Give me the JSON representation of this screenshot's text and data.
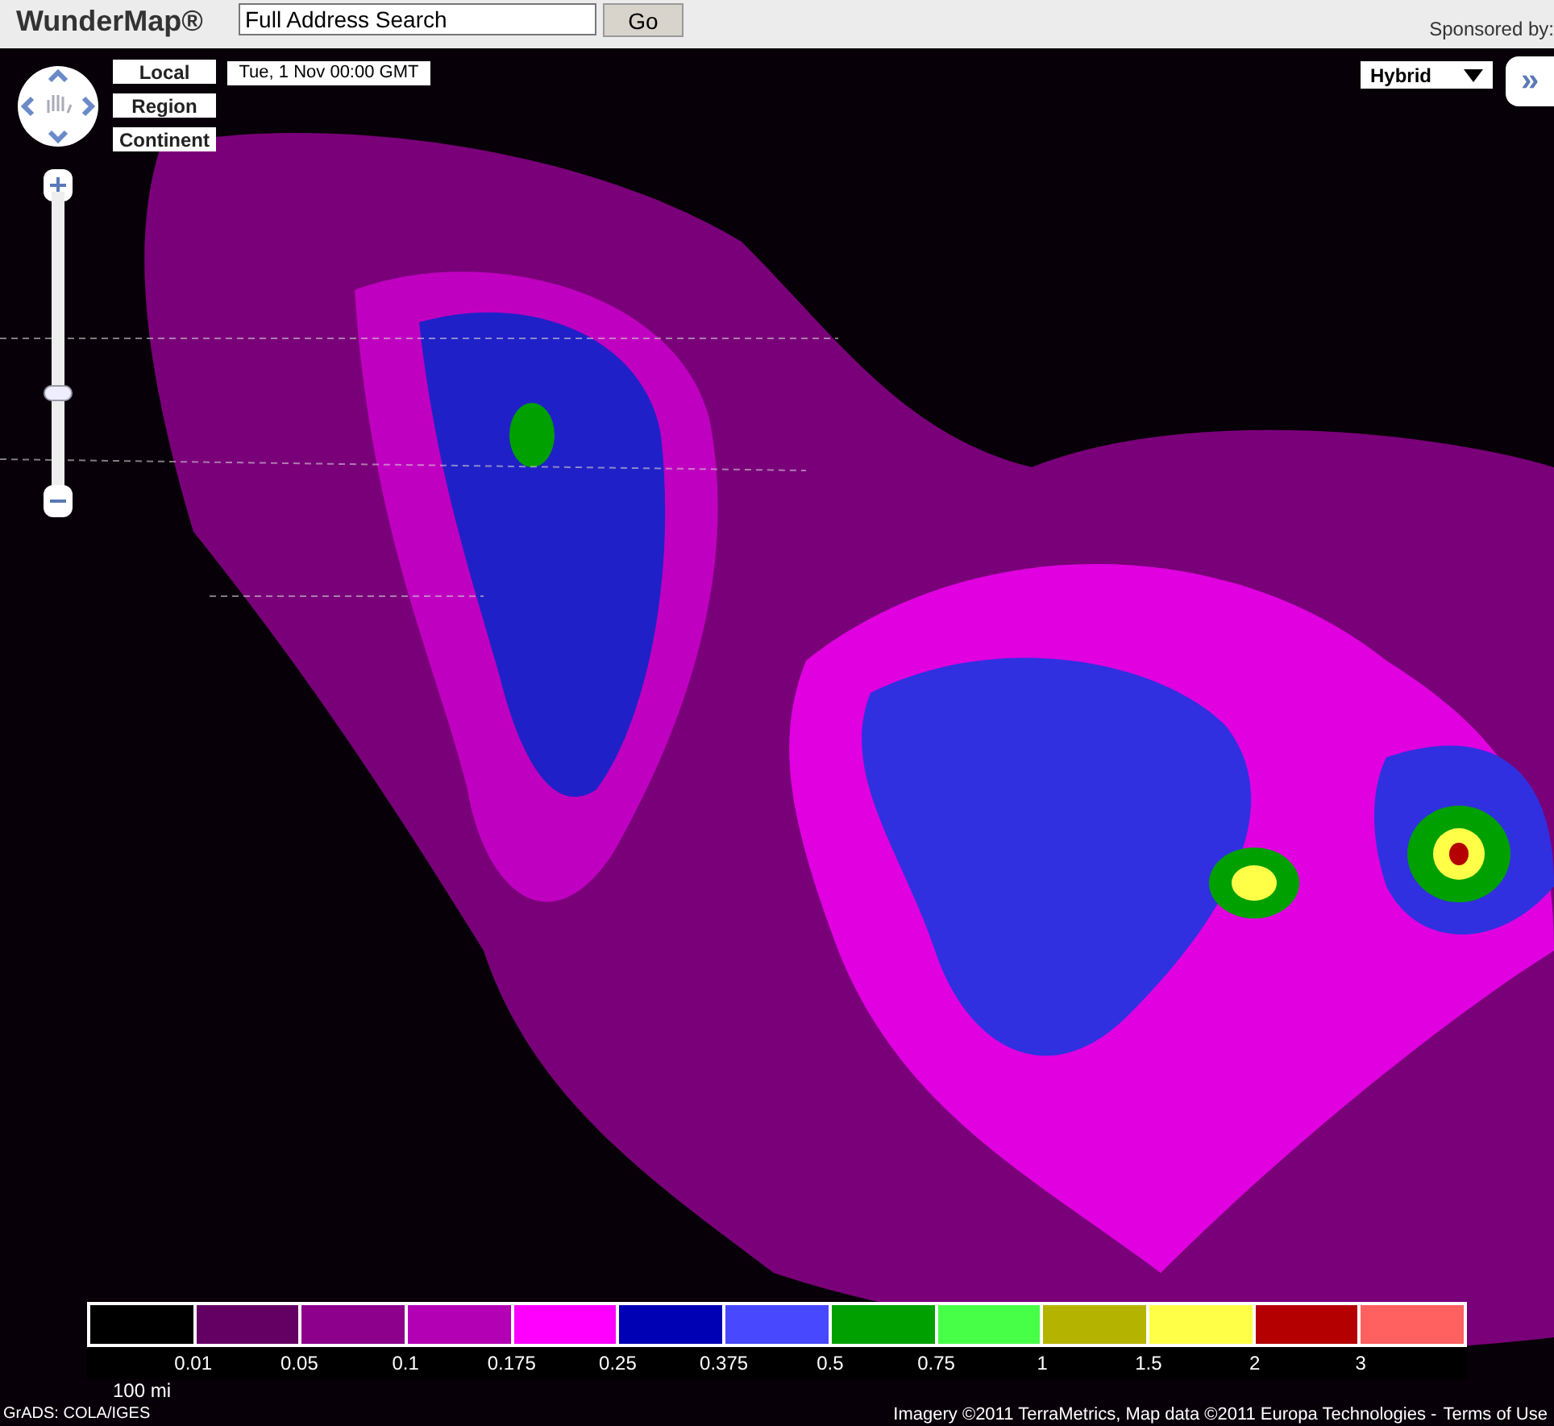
{
  "header": {
    "title": "WunderMap®",
    "search": {
      "value": "Full Address Search"
    },
    "go_button": "Go",
    "sponsor": "Sponsored by:"
  },
  "map": {
    "view_buttons": [
      {
        "label": "Local"
      },
      {
        "label": "Region"
      },
      {
        "label": "Continent"
      }
    ],
    "timestamp": "Tue, 1 Nov 00:00 GMT",
    "map_type": "Hybrid",
    "panel_toggle": "»",
    "zoom": {
      "level": 0.32
    },
    "legend": [
      {
        "color": "#000000",
        "label": "0.01"
      },
      {
        "color": "#640064",
        "label": "0.05"
      },
      {
        "color": "#8c008c",
        "label": "0.1"
      },
      {
        "color": "#b400b4",
        "label": "0.175"
      },
      {
        "color": "#ff00ff",
        "label": "0.25"
      },
      {
        "color": "#0000b4",
        "label": "0.375"
      },
      {
        "color": "#4848ff",
        "label": "0.5"
      },
      {
        "color": "#00a000",
        "label": "0.75"
      },
      {
        "color": "#48ff48",
        "label": "1"
      },
      {
        "color": "#b4b400",
        "label": "1.5"
      },
      {
        "color": "#ffff48",
        "label": "2"
      },
      {
        "color": "#b40000",
        "label": "3"
      },
      {
        "color": "#ff6060"
      }
    ],
    "scale": "100 mi",
    "credit": "GrADS: COLA/IGES",
    "attribution": "Imagery ©2011 TerraMetrics, Map data ©2011 Europa Technologies -",
    "terms_link": "Terms of Use"
  }
}
